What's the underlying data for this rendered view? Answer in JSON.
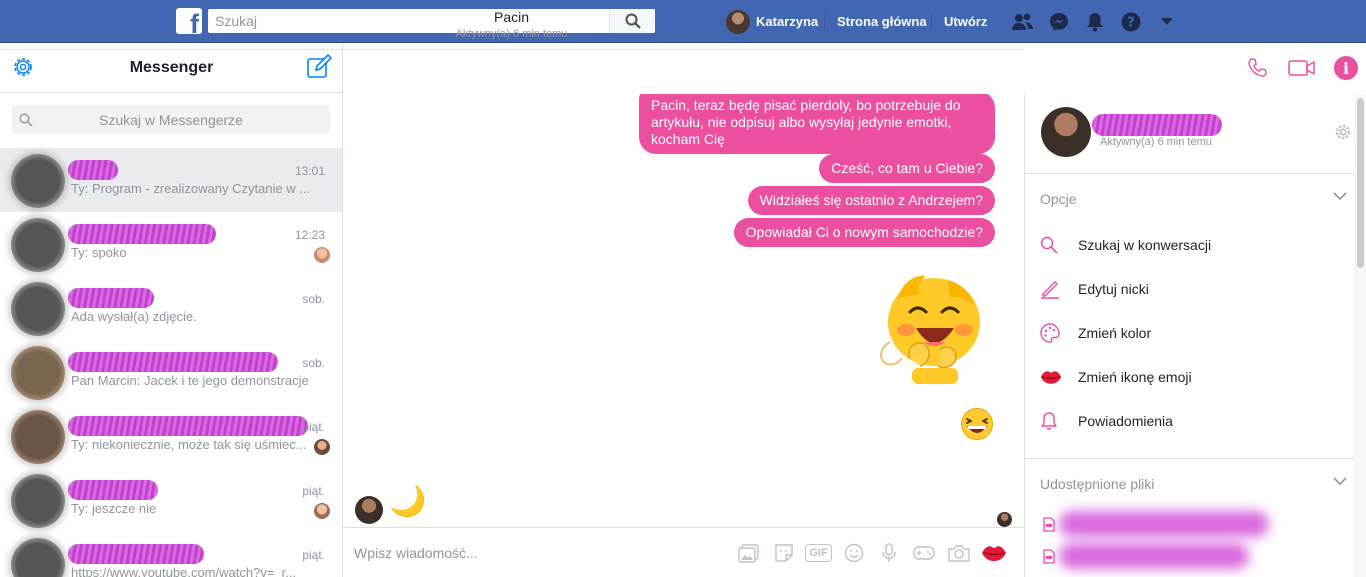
{
  "topbar": {
    "search_placeholder": "Szukaj",
    "user_name": "Katarzyna",
    "home_label": "Strona główna",
    "create_label": "Utwórz"
  },
  "left": {
    "title": "Messenger",
    "search_placeholder": "Szukaj w Messengerze",
    "conversations": [
      {
        "preview": "Ty: Program - zrealizowany Czytanie w ...",
        "time": "13:01"
      },
      {
        "preview": "Ty: spoko",
        "time": "12:23"
      },
      {
        "preview": "Ada wysłał(a) zdjęcie.",
        "time": "sob."
      },
      {
        "preview": "Pan Marcin: Jacek i te jego demonstracje",
        "time": "sob."
      },
      {
        "preview": "Ty: niekoniecznie, może tak się uśmiec...",
        "time": "piąt."
      },
      {
        "preview": "Ty: jeszcze nie",
        "time": "piąt."
      },
      {
        "preview": "https://www.youtube.com/watch?v=_r...",
        "time": "piąt."
      }
    ]
  },
  "chat": {
    "contact_name": "Pacin",
    "status": "Aktywny(a) 6 min temu",
    "messages": [
      "Pacin, teraz będę pisać pierdoly, bo potrzebuje do artykułu, nie odpisuj albo wysyłaj jedynie emotki, kocham Cię",
      "Cześć, co tam u Ciebie?",
      "Widziałeś się ostatnio z Andrzejem?",
      "Opowiadał Ci o nowym samochodzie?"
    ],
    "reply_emoji": "🌙",
    "composer_placeholder": "Wpisz wiadomość...",
    "gif_label": "GIF"
  },
  "details": {
    "status": "Aktywny(a) 6 min temu",
    "options_title": "Opcje",
    "options": [
      {
        "label": "Szukaj w konwersacji",
        "icon": "search-icon"
      },
      {
        "label": "Edytuj nicki",
        "icon": "pencil-icon"
      },
      {
        "label": "Zmień kolor",
        "icon": "palette-icon"
      },
      {
        "label": "Zmień ikonę emoji",
        "icon": "lips-icon"
      },
      {
        "label": "Powiadomienia",
        "icon": "bell-icon"
      }
    ],
    "files_title": "Udostępnione pliki"
  },
  "colors": {
    "brand": "#4267b2",
    "accent": "#ed4fa0",
    "messenger_blue": "#0084ff"
  }
}
